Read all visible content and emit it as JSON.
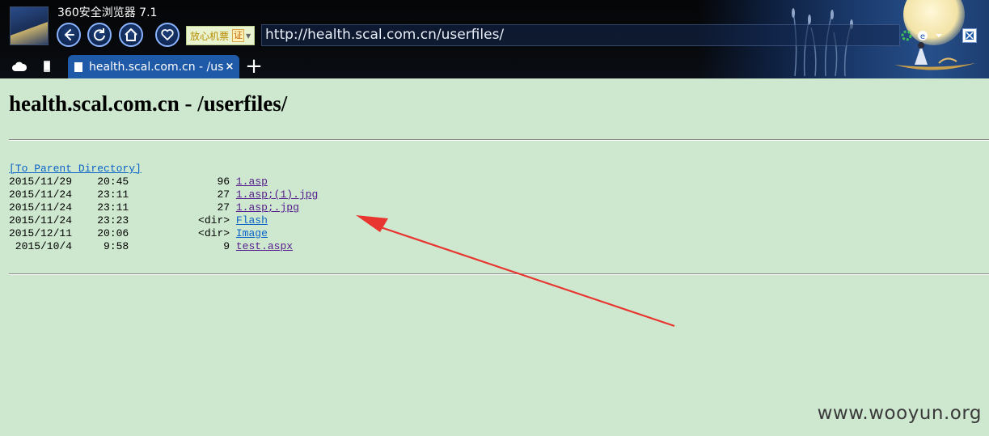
{
  "window": {
    "app_title": "360安全浏览器 7.1"
  },
  "toolbar": {
    "cert_label": "放心机票",
    "cert_mark": "证",
    "address": "http://health.scal.com.cn/userfiles/"
  },
  "tabs": [
    {
      "title": "health.scal.com.cn - /us",
      "close": "×"
    }
  ],
  "new_tab": "+",
  "page": {
    "heading": "health.scal.com.cn - /userfiles/",
    "parent_link": "[To Parent Directory]",
    "entries": [
      {
        "date": "2015/11/29",
        "time": "20:45",
        "size": "96",
        "name": "1.asp",
        "visited": true
      },
      {
        "date": "2015/11/24",
        "time": "23:11",
        "size": "27",
        "name": "1.asp;(1).jpg",
        "visited": true
      },
      {
        "date": "2015/11/24",
        "time": "23:11",
        "size": "27",
        "name": "1.asp;.jpg",
        "visited": true
      },
      {
        "date": "2015/11/24",
        "time": "23:23",
        "size": "<dir>",
        "name": "Flash",
        "visited": false
      },
      {
        "date": "2015/12/11",
        "time": "20:06",
        "size": "<dir>",
        "name": "Image",
        "visited": false
      },
      {
        "date": " 2015/10/4",
        "time": "9:58",
        "size": "9",
        "name": "test.aspx",
        "visited": true
      }
    ]
  },
  "watermark": "www.wooyun.org",
  "colors": {
    "page_background": "#cde8cf",
    "visited_link": "#551a8b",
    "unvisited_link": "#0b62c6",
    "annotation_arrow": "#e8352f",
    "tab_active": "#1f5aa8"
  }
}
